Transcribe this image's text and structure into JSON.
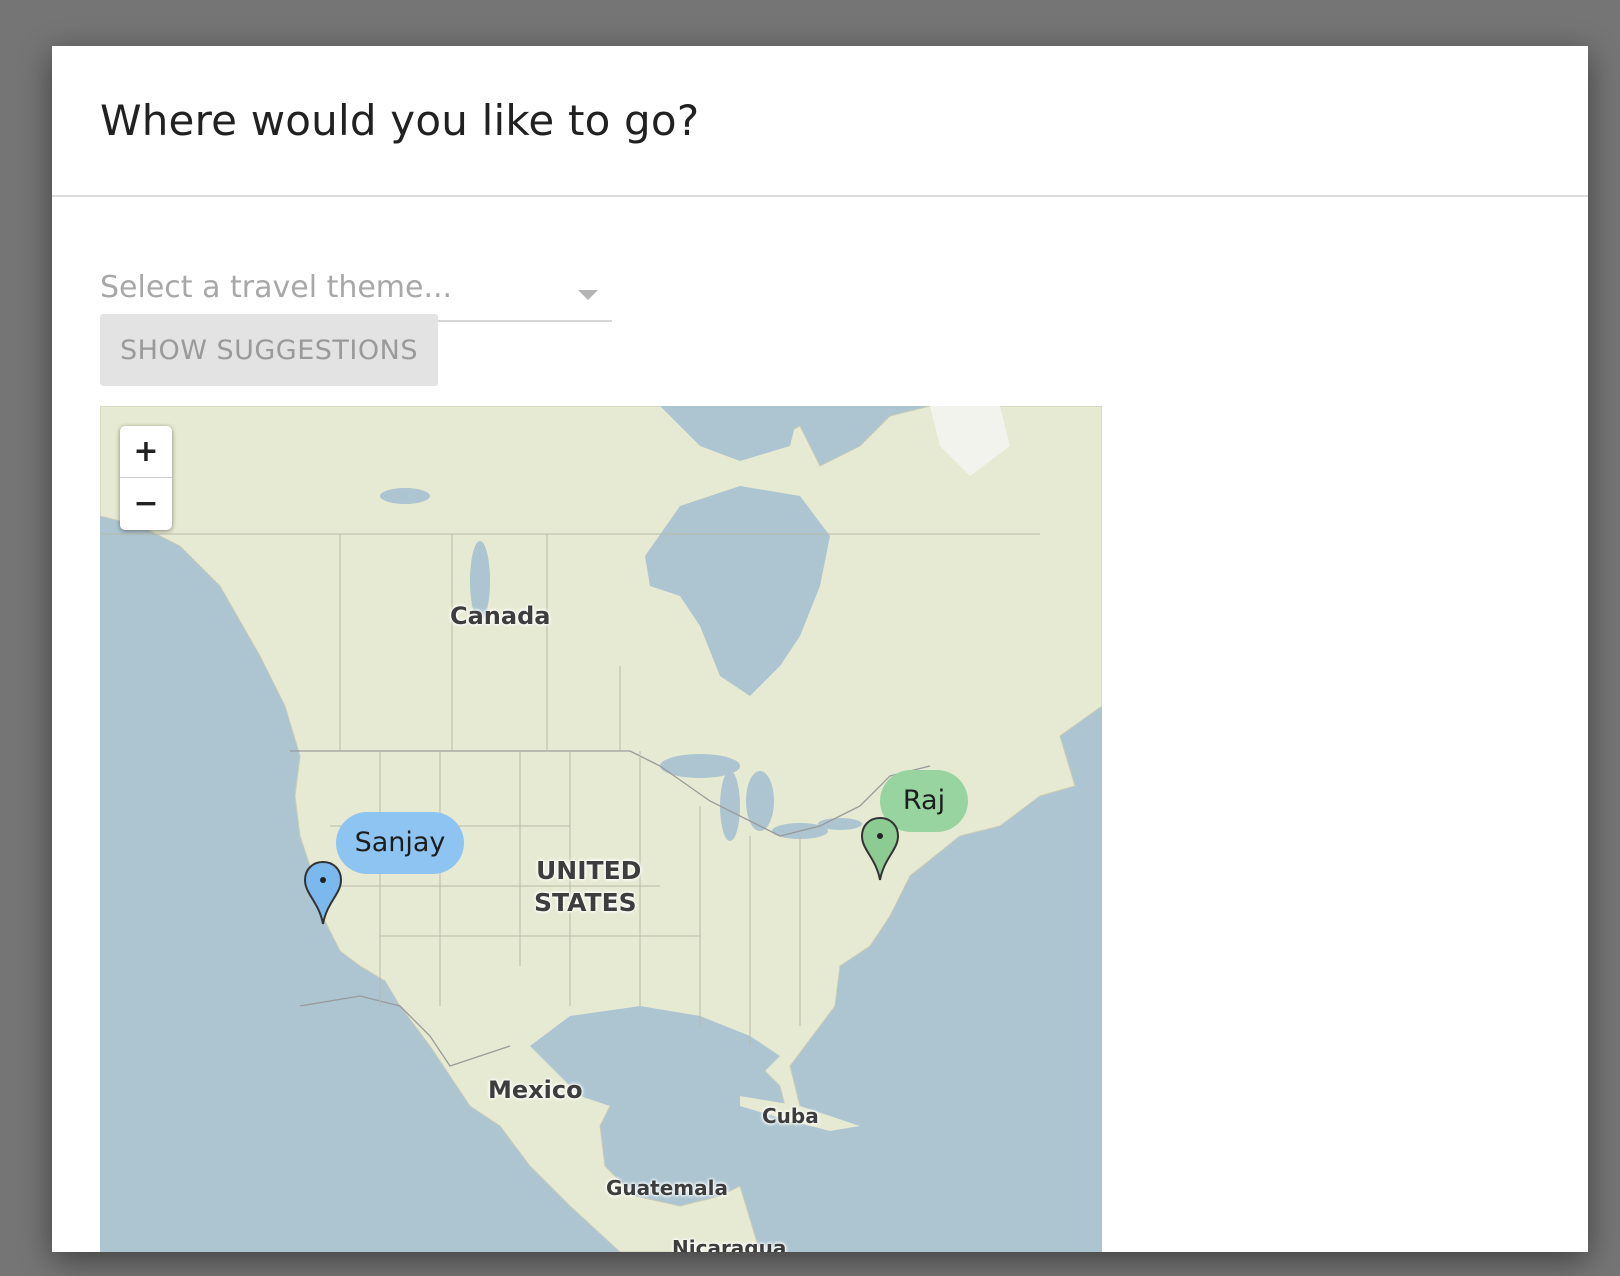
{
  "dialog": {
    "title": "Where would you like to go?"
  },
  "theme_select": {
    "placeholder": "Select a travel theme...",
    "selected": ""
  },
  "suggest_button": {
    "label": "SHOW SUGGESTIONS",
    "enabled": false
  },
  "map": {
    "zoom_in_label": "+",
    "zoom_out_label": "−",
    "country_labels": {
      "canada": "Canada",
      "united_states_line1": "UNITED",
      "united_states_line2": "STATES",
      "mexico": "Mexico",
      "cuba": "Cuba",
      "guatemala": "Guatemala",
      "nicaragua": "Nicaragua"
    },
    "markers": [
      {
        "name": "Sanjay",
        "color": "#8ec4f2",
        "pin_color": "#7bb8ee"
      },
      {
        "name": "Raj",
        "color": "#98d4a0",
        "pin_color": "#8ccc93"
      }
    ],
    "colors": {
      "water": "#acc5d1",
      "land": "#e7ead2"
    }
  }
}
